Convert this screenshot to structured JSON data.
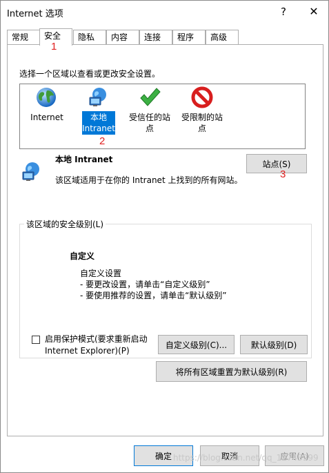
{
  "window": {
    "title": "Internet 选项",
    "help_glyph": "?",
    "close_glyph": "✕"
  },
  "tabs": [
    {
      "label": "常规"
    },
    {
      "label": "安全",
      "active": true
    },
    {
      "label": "隐私"
    },
    {
      "label": "内容"
    },
    {
      "label": "连接"
    },
    {
      "label": "程序"
    },
    {
      "label": "高级"
    }
  ],
  "annotations": [
    "1",
    "2",
    "3"
  ],
  "security": {
    "zone_prompt": "选择一个区域以查看或更改安全设置。",
    "zones": [
      {
        "label": "Internet",
        "icon": "globe-icon"
      },
      {
        "label": "本地\nIntranet",
        "icon": "intranet-icon",
        "selected": true
      },
      {
        "label": "受信任的站\n点",
        "icon": "checkmark-icon"
      },
      {
        "label": "受限制的站\n点",
        "icon": "restricted-icon"
      }
    ],
    "selected_zone_title": "本地 Intranet",
    "selected_zone_desc": "该区域适用于在你的 Intranet 上找到的所有网站。",
    "sites_button": "站点(S)",
    "group_label": "该区域的安全级别(L)",
    "level_title": "自定义",
    "level_lines": [
      "自定义设置",
      "- 要更改设置，请单击“自定义级别”",
      "- 要使用推荐的设置，请单击“默认级别”"
    ],
    "protected_mode_label": "启用保护模式(要求重新启动\nInternet Explorer)(P)",
    "protected_mode_checked": false,
    "custom_level_button": "自定义级别(C)...",
    "default_level_button": "默认级别(D)",
    "reset_all_button": "将所有区域重置为默认级别(R)"
  },
  "footer": {
    "ok": "确定",
    "cancel": "取消",
    "apply": "应用(A)"
  },
  "watermark": "https://blog.csdn.net/qq_12743999",
  "colors": {
    "accent": "#0078d7",
    "annotation": "#e02020",
    "button_face": "#e1e1e1"
  }
}
